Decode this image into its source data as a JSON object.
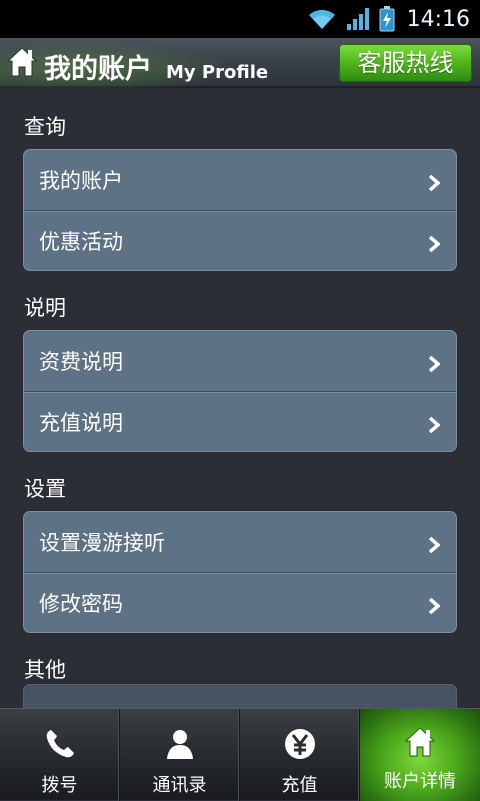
{
  "status_bar": {
    "time": "14:16",
    "icons": [
      "wifi-icon",
      "signal-icon",
      "battery-icon"
    ]
  },
  "header": {
    "title": "我的账户",
    "subtitle": "My Profile",
    "hotline_label": "客服热线",
    "home_icon": "home-icon"
  },
  "sections": [
    {
      "title": "查询",
      "items": [
        "我的账户",
        "优惠活动"
      ]
    },
    {
      "title": "说明",
      "items": [
        "资费说明",
        "充值说明"
      ]
    },
    {
      "title": "设置",
      "items": [
        "设置漫游接听",
        "修改密码"
      ]
    },
    {
      "title": "其他",
      "items": []
    }
  ],
  "tabs": [
    {
      "label": "拨号",
      "icon": "phone-icon",
      "active": false
    },
    {
      "label": "通讯录",
      "icon": "contact-icon",
      "active": false
    },
    {
      "label": "充值",
      "icon": "yen-icon",
      "active": false
    },
    {
      "label": "账户详情",
      "icon": "home-icon",
      "active": true
    }
  ],
  "colors": {
    "accent_green": "#4fb51d",
    "card": "#5e7286",
    "background": "#2b2e35"
  }
}
